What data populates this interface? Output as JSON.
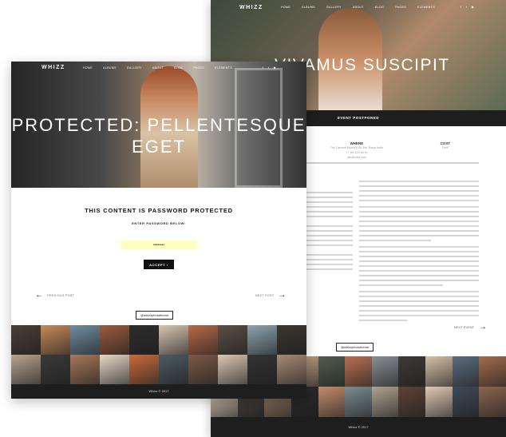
{
  "back_page": {
    "logo": "WHIZZ",
    "nav": [
      "HOME",
      "ALBUMS",
      "GALLERY",
      "ABOUT",
      "BLOG",
      "PAGES",
      "ELEMENTS"
    ],
    "social": [
      "f",
      "t",
      "▶"
    ],
    "hero_title": "VIVAMUS SUSCIPIT",
    "event_status": "EVENT POSTPONED",
    "event": {
      "where_label": "WHERE",
      "where_lines": [
        "The Carnival Room(9) Av. Del, Borgo Italia",
        "+7 100 622 65 40",
        "info@whiz.com"
      ],
      "cost_label": "COST",
      "cost_value": "Free"
    },
    "next_label": "NEXT EVENT",
    "instagram_badge": "@whizzphototheme",
    "footer": "Whizz © 2017",
    "photo_colors": [
      "#6b4a3a",
      "#a08a74",
      "#2f3a45",
      "#c9a58a",
      "#4f5e4c",
      "#b87052",
      "#8a8f96",
      "#3d3a38",
      "#d6bfa6",
      "#5a6d7e",
      "#a36d4a",
      "#e2d3c0",
      "#4a4440",
      "#9c7d68",
      "#2b2b2b",
      "#c48c6c",
      "#7a8c90",
      "#b0a190",
      "#5d4336",
      "#e0c9b5",
      "#3f4b57",
      "#8b6550"
    ]
  },
  "front_page": {
    "logo": "WHIZZ",
    "nav": [
      "HOME",
      "ALBUMS",
      "GALLERY",
      "ABOUT",
      "BLOG",
      "PAGES",
      "ELEMENTS"
    ],
    "social": [
      "f",
      "t",
      "▶"
    ],
    "hero_title": "PROTECTED: PELLENTESQUE EGET",
    "protected_heading": "THIS CONTENT IS PASSWORD PROTECTED",
    "password_label": "ENTER PASSWORD BELOW:",
    "password_value": "••••••••",
    "accept_label": "ACCEPT ›",
    "prev_label": "PREVIOUS POST",
    "next_label": "NEXT POST",
    "instagram_badge": "@whizzphototheme",
    "footer": "Whizz © 2017",
    "photo_colors": [
      "#4a3f36",
      "#c78a5a",
      "#6f8da0",
      "#9a5a3e",
      "#2d2d2d",
      "#d6c4b0",
      "#b86a48",
      "#5a4e45",
      "#8da3ae",
      "#3b3630",
      "#b9a48e",
      "#3a3a3a",
      "#a6785a",
      "#e6d8c8",
      "#c96b3d",
      "#4d5a63",
      "#7b5a48",
      "#dcc7b2",
      "#333",
      "#a88a76"
    ]
  }
}
